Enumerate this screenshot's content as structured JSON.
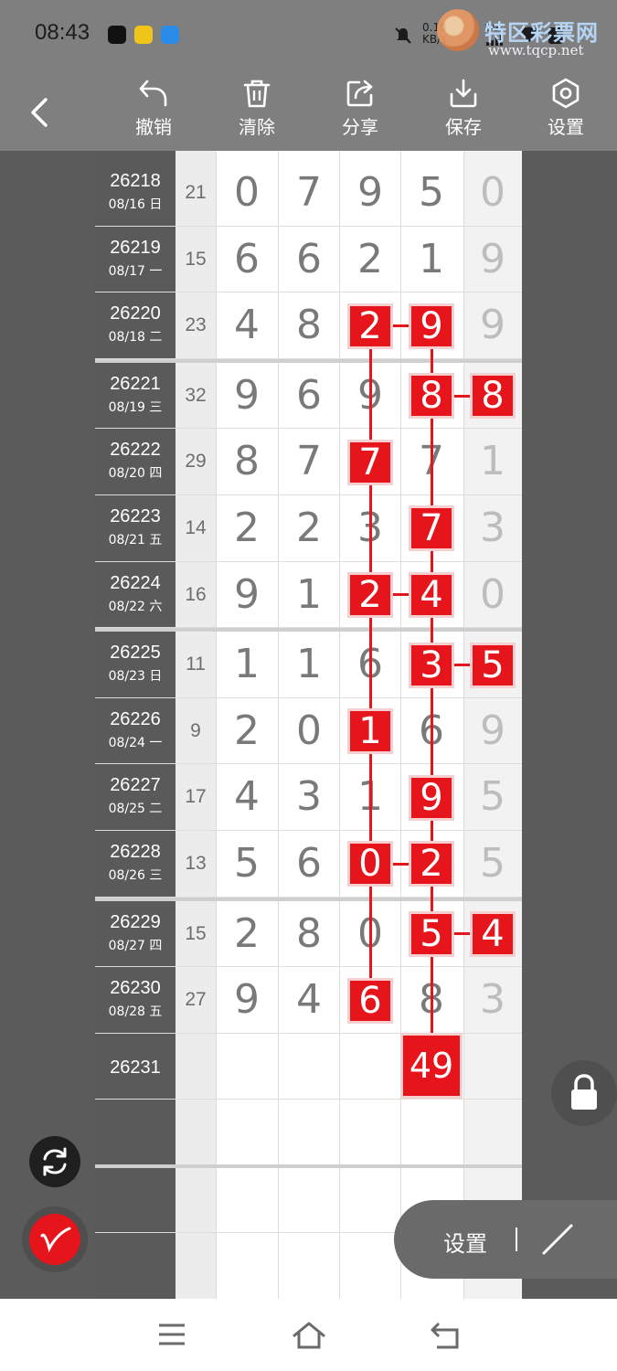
{
  "status": {
    "time": "08:43",
    "speed_value": "0.10",
    "speed_unit": "KB/s",
    "net": "5G"
  },
  "watermark": {
    "title": "特区彩票网",
    "url": "www.tqcp.net"
  },
  "toolbar": {
    "undo": "撤销",
    "clear": "清除",
    "share": "分享",
    "save": "保存",
    "settings": "设置"
  },
  "colors": {
    "accent": "#e6141b",
    "toolbar_bg": "#7f7f7f",
    "issue_col_bg": "#5a5a5a"
  },
  "rows": [
    {
      "issue": "26218",
      "date": "08/16 日",
      "sum": "21",
      "digits": [
        "0",
        "7",
        "9",
        "5",
        "0"
      ]
    },
    {
      "issue": "26219",
      "date": "08/17 一",
      "sum": "15",
      "digits": [
        "6",
        "6",
        "2",
        "1",
        "9"
      ]
    },
    {
      "issue": "26220",
      "date": "08/18 二",
      "sum": "23",
      "digits": [
        "4",
        "8",
        "2",
        "9",
        "9"
      ]
    },
    {
      "issue": "26221",
      "date": "08/19 三",
      "sum": "32",
      "digits": [
        "9",
        "6",
        "9",
        "8",
        "8"
      ]
    },
    {
      "issue": "26222",
      "date": "08/20 四",
      "sum": "29",
      "digits": [
        "8",
        "7",
        "7",
        "7",
        "1"
      ]
    },
    {
      "issue": "26223",
      "date": "08/21 五",
      "sum": "14",
      "digits": [
        "2",
        "2",
        "3",
        "7",
        "3"
      ]
    },
    {
      "issue": "26224",
      "date": "08/22 六",
      "sum": "16",
      "digits": [
        "9",
        "1",
        "2",
        "4",
        "0"
      ]
    },
    {
      "issue": "26225",
      "date": "08/23 日",
      "sum": "11",
      "digits": [
        "1",
        "1",
        "6",
        "3",
        "5"
      ]
    },
    {
      "issue": "26226",
      "date": "08/24 一",
      "sum": "9",
      "digits": [
        "2",
        "0",
        "1",
        "6",
        "9"
      ]
    },
    {
      "issue": "26227",
      "date": "08/25 二",
      "sum": "17",
      "digits": [
        "4",
        "3",
        "1",
        "9",
        "5"
      ]
    },
    {
      "issue": "26228",
      "date": "08/26 三",
      "sum": "13",
      "digits": [
        "5",
        "6",
        "0",
        "2",
        "5"
      ]
    },
    {
      "issue": "26229",
      "date": "08/27 四",
      "sum": "15",
      "digits": [
        "2",
        "8",
        "0",
        "5",
        "4"
      ]
    },
    {
      "issue": "26230",
      "date": "08/28 五",
      "sum": "27",
      "digits": [
        "9",
        "4",
        "6",
        "8",
        "3"
      ]
    },
    {
      "issue": "26231",
      "date": "",
      "sum": "",
      "digits": [
        "",
        "",
        "",
        "",
        ""
      ]
    }
  ],
  "highlights": [
    {
      "row": 2,
      "col": 2
    },
    {
      "row": 2,
      "col": 3
    },
    {
      "row": 3,
      "col": 3
    },
    {
      "row": 3,
      "col": 4
    },
    {
      "row": 4,
      "col": 2
    },
    {
      "row": 5,
      "col": 3
    },
    {
      "row": 6,
      "col": 2
    },
    {
      "row": 6,
      "col": 3
    },
    {
      "row": 7,
      "col": 3
    },
    {
      "row": 7,
      "col": 4
    },
    {
      "row": 8,
      "col": 2
    },
    {
      "row": 9,
      "col": 3
    },
    {
      "row": 10,
      "col": 2
    },
    {
      "row": 10,
      "col": 3
    },
    {
      "row": 11,
      "col": 3
    },
    {
      "row": 11,
      "col": 4
    },
    {
      "row": 12,
      "col": 2
    }
  ],
  "prediction": "49",
  "panel": {
    "label": "设置"
  }
}
